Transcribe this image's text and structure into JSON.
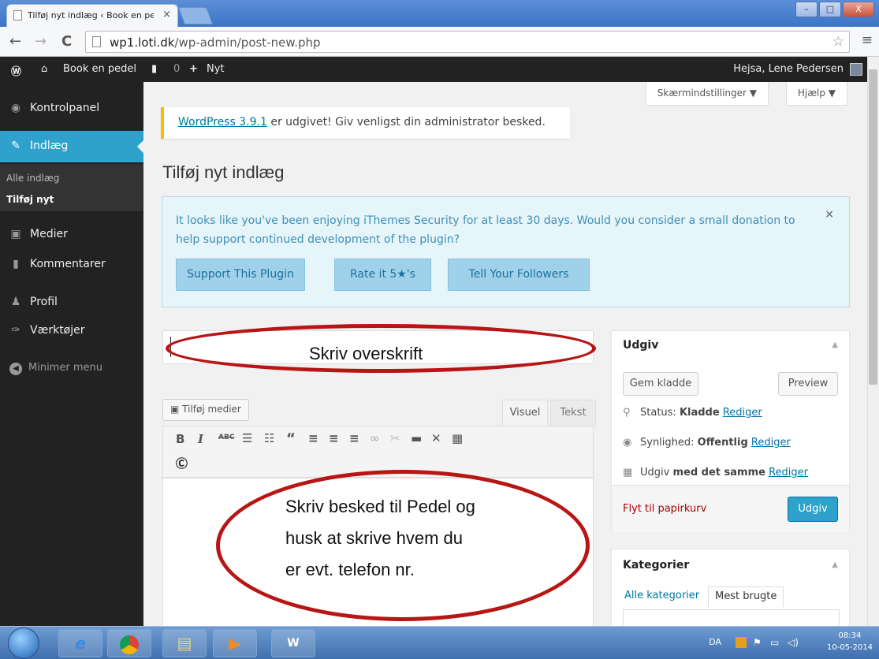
{
  "browser": {
    "tab_title": "Tilføj nyt indlæg ‹ Book en pedel",
    "tab_close": "×",
    "url_host": "wp1.loti.dk",
    "url_path": "/wp-admin/post-new.php",
    "win_min": "–",
    "win_max": "□",
    "win_close": "X"
  },
  "adminbar": {
    "site_name": "Book en pedel",
    "comments_count": "0",
    "new_label": "Nyt",
    "greeting": "Hejsa, Lene Pedersen"
  },
  "sidebar": {
    "items": [
      {
        "label": "Kontrolpanel",
        "icon": "dashboard-icon"
      },
      {
        "label": "Indlæg",
        "icon": "pin-icon"
      },
      {
        "label": "Medier",
        "icon": "media-icon"
      },
      {
        "label": "Kommentarer",
        "icon": "comment-icon"
      },
      {
        "label": "Profil",
        "icon": "user-icon"
      },
      {
        "label": "Værktøjer",
        "icon": "wrench-icon"
      }
    ],
    "sub_items": [
      "Alle indlæg",
      "Tilføj nyt"
    ],
    "collapse_label": "Minimer menu"
  },
  "screen_options": {
    "label": "Skærmindstillinger ▼"
  },
  "help": {
    "label": "Hjælp ▼"
  },
  "update_notice": {
    "link": "WordPress 3.9.1",
    "text": " er udgivet! Giv venligst din administrator besked."
  },
  "page_title": "Tilføj nyt indlæg",
  "ithemes": {
    "message": "It looks like you've been enjoying iThemes Security for at least 30 days. Would you consider a small donation to help support continued development of the plugin?",
    "close": "×",
    "buttons": [
      "Support This Plugin",
      "Rate it 5★'s",
      "Tell Your Followers"
    ]
  },
  "annotations": {
    "title_hint": "Skriv overskrift",
    "body_line1": "Skriv besked til Pedel og",
    "body_line2": "husk at skrive hvem du",
    "body_line3": "er evt. telefon nr."
  },
  "editor": {
    "add_media": "Tilføj medier",
    "tab_visual": "Visuel",
    "tab_text": "Tekst"
  },
  "publish_box": {
    "title": "Udgiv",
    "save_draft": "Gem kladde",
    "preview": "Preview",
    "status_label": "Status: ",
    "status_value": "Kladde",
    "visibility_label": "Synlighed: ",
    "visibility_value": "Offentlig",
    "publish_prefix": "Udgiv ",
    "publish_when": "med det samme",
    "edit_link": "Rediger",
    "trash": "Flyt til papirkurv",
    "publish_button": "Udgiv"
  },
  "categories_box": {
    "title": "Kategorier",
    "tab_all": "Alle kategorier",
    "tab_most": "Mest brugte"
  },
  "taskbar": {
    "lang": "DA",
    "time": "08:34",
    "date": "10-05-2014"
  }
}
